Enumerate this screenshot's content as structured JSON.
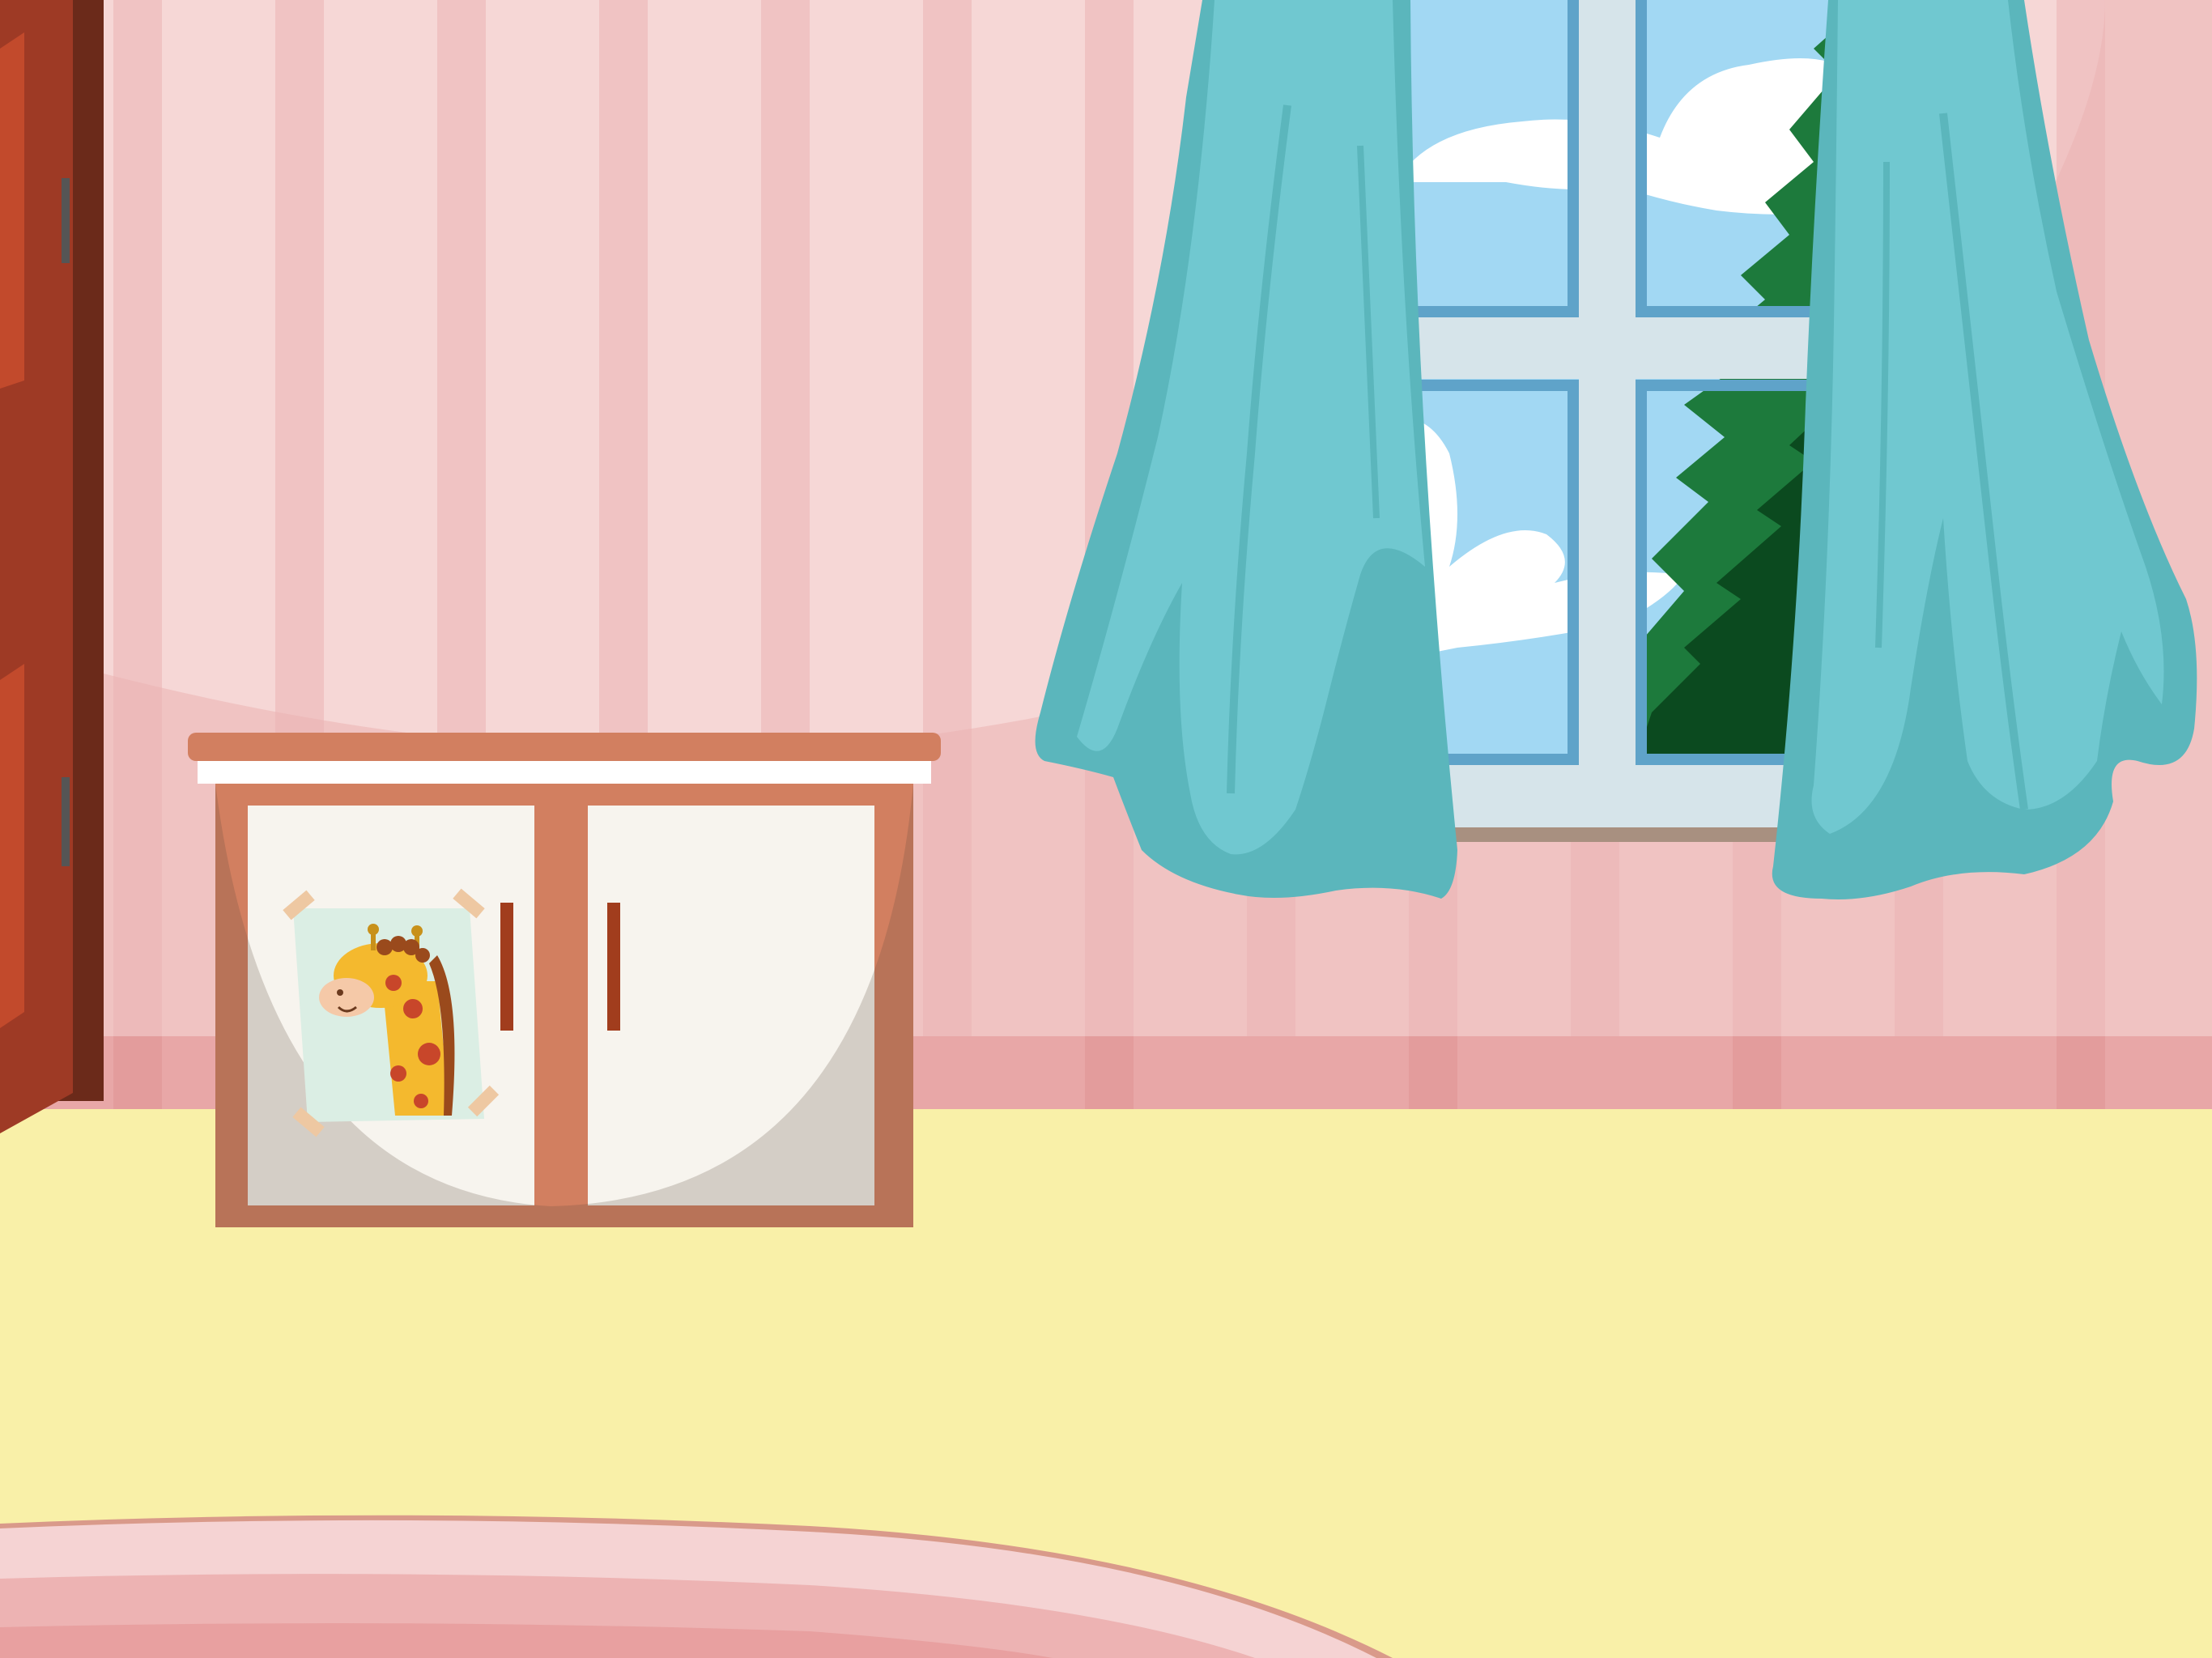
{
  "scene": {
    "kind": "cartoon-bedroom-background",
    "objects": [
      "wall",
      "door",
      "cabinet",
      "giraffe-drawing",
      "window",
      "pine-tree",
      "clouds",
      "curtain-left",
      "curtain-right",
      "floor",
      "rug"
    ]
  },
  "colors": {
    "wall_light": "#f6d7d6",
    "wall_stripe": "#f0c3c3",
    "wall_shadow": "#ebb3b3",
    "baseboard": "#e8a7a7",
    "floor": "#f9f0a8",
    "rug": "#f5d3d3",
    "door": "#9e3a25",
    "cabinet_frame": "#d27f60",
    "cabinet_panel": "#f7f4ee",
    "sky": "#a2d8f3",
    "window_frame": "#d6e4ea",
    "tree_dark": "#0b4a1f",
    "tree_light": "#1d7a3c",
    "curtain": "#70c8d0",
    "curtain_shadow": "#5bb6bc",
    "giraffe": "#f4b92e"
  }
}
